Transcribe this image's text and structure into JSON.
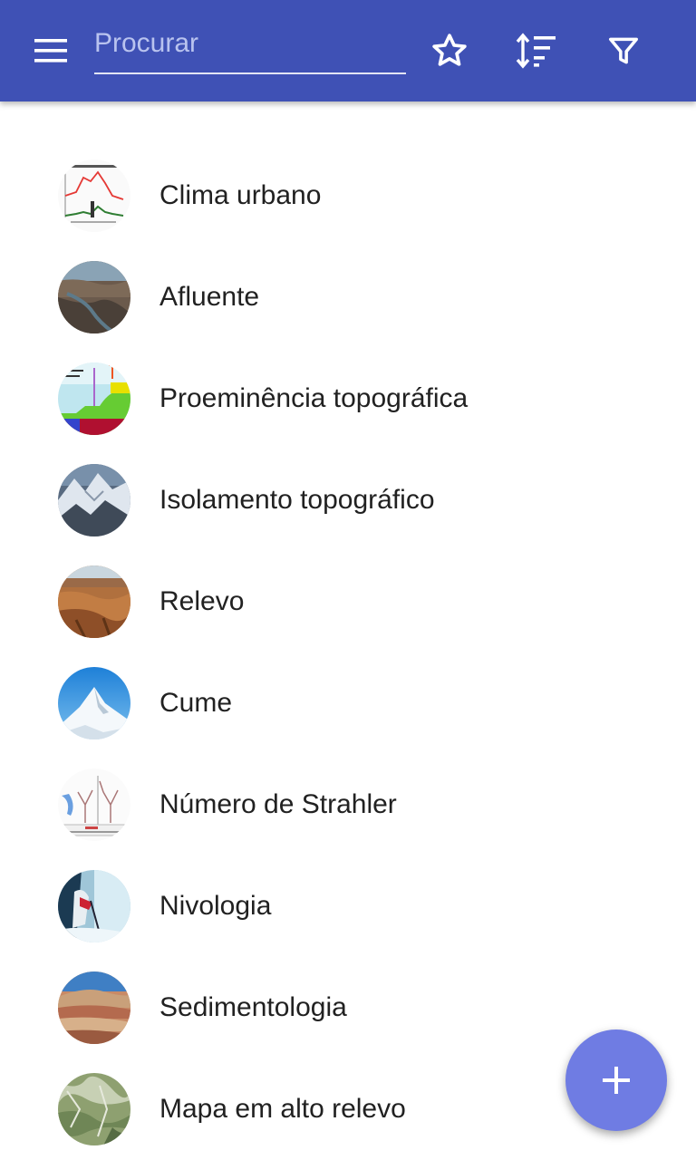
{
  "header": {
    "search_placeholder": "Procurar",
    "search_value": "",
    "background_color": "#3f51b5",
    "icons": [
      "menu-icon",
      "star-icon",
      "sort-icon",
      "filter-icon"
    ]
  },
  "list": {
    "items": [
      {
        "label": "Clima urbano",
        "thumbnail": "urban-heat-island-chart"
      },
      {
        "label": "Afluente",
        "thumbnail": "river-canyon-aerial"
      },
      {
        "label": "Proeminência topográfica",
        "thumbnail": "prominence-diagram"
      },
      {
        "label": "Isolamento topográfico",
        "thumbnail": "snowy-mountains"
      },
      {
        "label": "Relevo",
        "thumbnail": "canyon-landscape"
      },
      {
        "label": "Cume",
        "thumbnail": "snow-peak"
      },
      {
        "label": "Número de Strahler",
        "thumbnail": "stream-order-diagram"
      },
      {
        "label": "Nivologia",
        "thumbnail": "snow-researcher"
      },
      {
        "label": "Sedimentologia",
        "thumbnail": "sediment-layers"
      },
      {
        "label": "Mapa em alto relevo",
        "thumbnail": "relief-map"
      }
    ]
  },
  "fab": {
    "icon": "plus-icon",
    "color": "#6f7ce3"
  }
}
